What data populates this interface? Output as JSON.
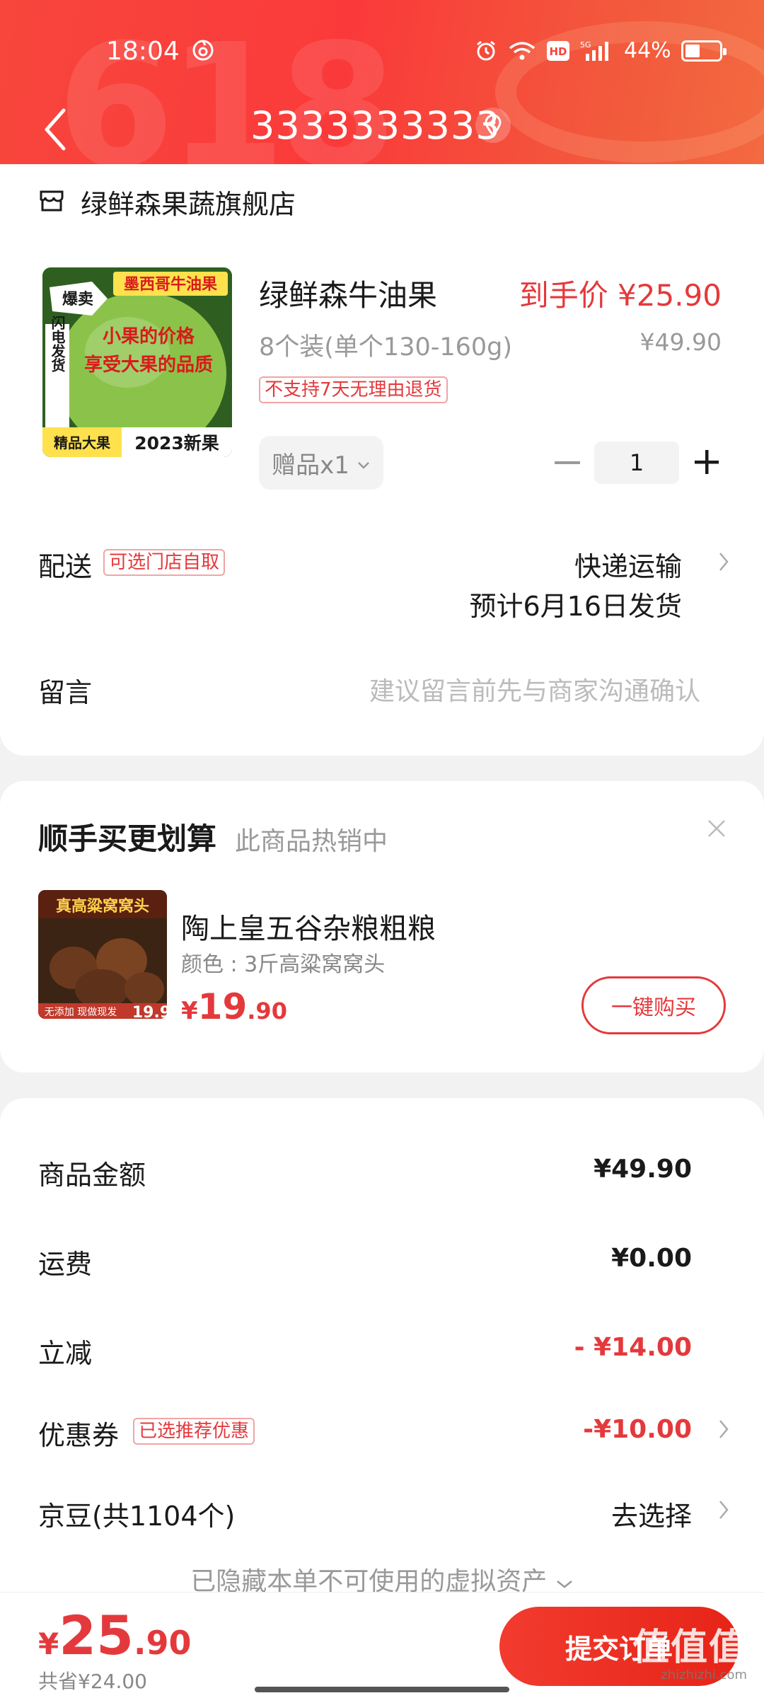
{
  "status_bar": {
    "time": "18:04",
    "battery": "44%",
    "network": "5G",
    "hd": "HD"
  },
  "header": {
    "title": "3333333333",
    "watermark": "618"
  },
  "store": {
    "name": "绿鲜森果蔬旗舰店"
  },
  "product": {
    "name": "绿鲜森牛油果",
    "deal_price": "到手价 ¥25.90",
    "spec": "8个装(单个130-160g)",
    "original_price": "¥49.90",
    "return_tag": "不支持7天无理由退货",
    "gift": "赠品x1",
    "quantity": "1",
    "image_texts": {
      "top": "墨西哥牛油果",
      "hot": "爆卖",
      "side": "闪电发货",
      "line1": "小果的价格",
      "line2": "享受大果的品质",
      "bottom_left": "精品大果",
      "bottom_right": "2023新果"
    }
  },
  "delivery": {
    "label": "配送",
    "tag": "可选门店自取",
    "method": "快递运输",
    "date": "预计6月16日发货"
  },
  "note": {
    "label": "留言",
    "placeholder": "建议留言前先与商家沟通确认"
  },
  "upsell": {
    "title": "顺手买更划算",
    "subtitle": "此商品热销中",
    "item_name": "陶上皇五谷杂粮粗粮",
    "item_spec": "颜色 : 3斤高粱窝窝头",
    "price_currency": "¥",
    "price_int": "19",
    "price_dec": ".90",
    "button": "一键购买",
    "image_texts": {
      "top": "真高粱窝窝头",
      "bottom": "无添加 现做现发",
      "price": "19.9"
    }
  },
  "summary": {
    "goods_label": "商品金额",
    "goods_value": "¥49.90",
    "shipping_label": "运费",
    "shipping_value": "¥0.00",
    "discount_label": "立减",
    "discount_value": "- ¥14.00",
    "coupon_label": "优惠券",
    "coupon_tag": "已选推荐优惠",
    "coupon_value": "-¥10.00",
    "jingdou_label": "京豆(共1104个)",
    "jingdou_action": "去选择",
    "hidden_assets": "已隐藏本单不可使用的虚拟资产"
  },
  "bottom_bar": {
    "currency": "¥",
    "total_int": "25",
    "total_dec": ".90",
    "saved": "共省¥24.00",
    "submit": "提交订单"
  },
  "watermark": {
    "brand": "值值值",
    "domain": "zhizhizhi.com"
  },
  "colors": {
    "accent_red": "#e4393c",
    "header_red": "#fa3a3a"
  }
}
